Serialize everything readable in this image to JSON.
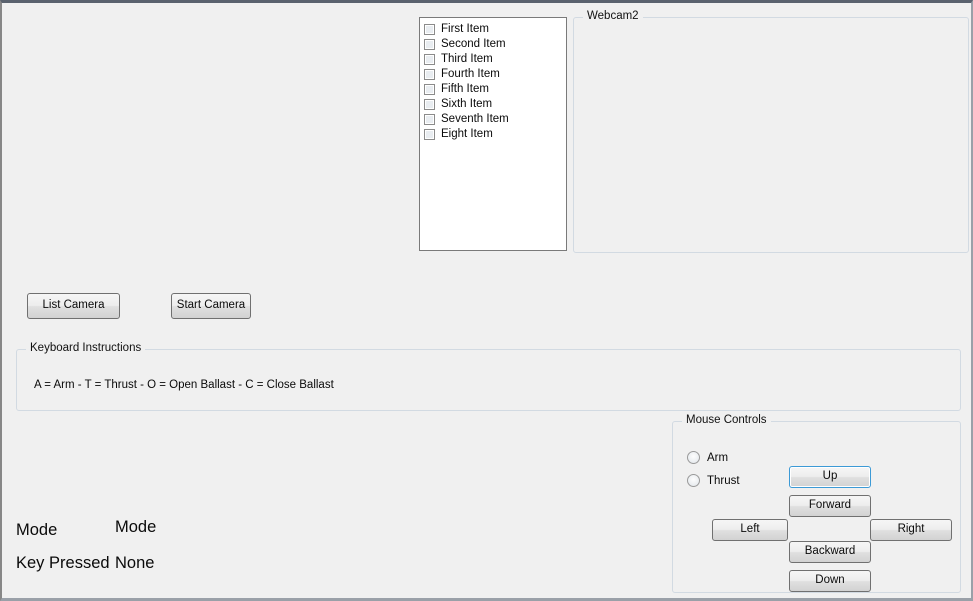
{
  "window": {
    "background_color": "#f0f0f0",
    "border_color": "#5a626e"
  },
  "camera_list": {
    "name": "checked-list-box",
    "items": [
      {
        "label": "First Item",
        "checked": false
      },
      {
        "label": "Second Item",
        "checked": false
      },
      {
        "label": "Third Item",
        "checked": false
      },
      {
        "label": "Fourth Item",
        "checked": false
      },
      {
        "label": "Fifth Item",
        "checked": false
      },
      {
        "label": "Sixth Item",
        "checked": false
      },
      {
        "label": "Seventh Item",
        "checked": false
      },
      {
        "label": "Eight Item",
        "checked": false
      }
    ]
  },
  "webcam_group": {
    "legend": "Webcam2",
    "content": ""
  },
  "camera_buttons": {
    "list_camera": "List Camera",
    "start_camera": "Start Camera"
  },
  "keyboard_instructions": {
    "legend": "Keyboard Instructions",
    "text": "A = Arm  -  T = Thrust  -  O = Open Ballast  -  C = Close Ballast"
  },
  "status": {
    "mode_caption": "Mode",
    "mode_value": "Mode",
    "key_caption": "Key Pressed",
    "key_value": "None"
  },
  "mouse_controls": {
    "legend": "Mouse Controls",
    "radios": [
      {
        "label": "Arm",
        "selected": false
      },
      {
        "label": "Thrust",
        "selected": false
      }
    ],
    "buttons": {
      "up": "Up",
      "forward": "Forward",
      "left": "Left",
      "right": "Right",
      "backward": "Backward",
      "down": "Down"
    },
    "focused_button": "Up",
    "focus_color": "#3c9ad6"
  }
}
